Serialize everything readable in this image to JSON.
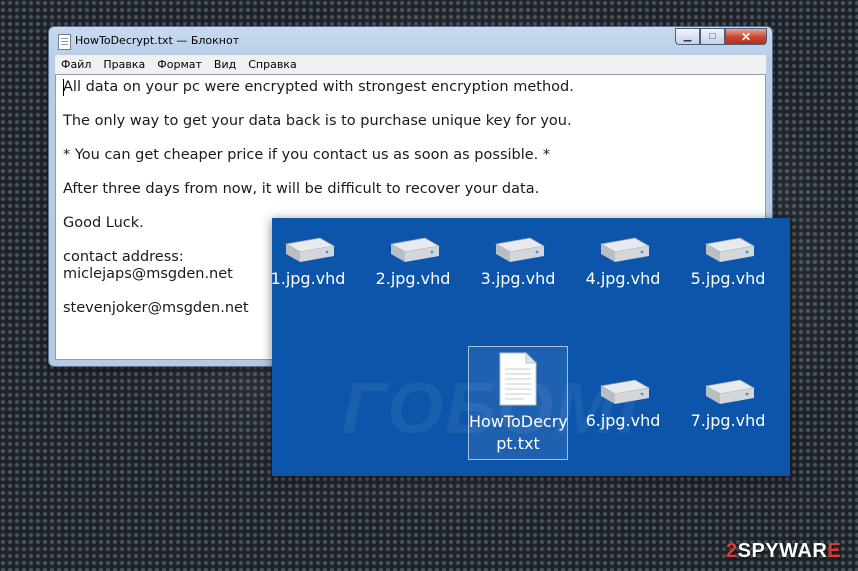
{
  "notepad": {
    "title": "HowToDecrypt.txt — Блокнот",
    "menu": [
      "Файл",
      "Правка",
      "Формат",
      "Вид",
      "Справка"
    ],
    "lines": [
      "All data on your pc were encrypted with strongest encryption method.",
      "The only way to get your data back is to purchase unique key for you.",
      "* You can get cheaper price if you contact us as soon as possible. *",
      "After three days from now, it will be difficult to recover your data.",
      "Good Luck.",
      "contact address:",
      "miclejaps@msgden.net",
      "stevenjoker@msgden.net"
    ]
  },
  "explorer": {
    "files_row1": [
      "1.jpg.vhd",
      "2.jpg.vhd",
      "3.jpg.vhd",
      "4.jpg.vhd",
      "5.jpg.vhd"
    ],
    "selected_file": {
      "line1": "HowToDecry",
      "line2": "pt.txt"
    },
    "files_row2": [
      "6.jpg.vhd",
      "7.jpg.vhd"
    ],
    "background_color": "#0d55aa"
  },
  "logo": {
    "num": "2",
    "part1": "SPYWAR",
    "part2": "E"
  }
}
